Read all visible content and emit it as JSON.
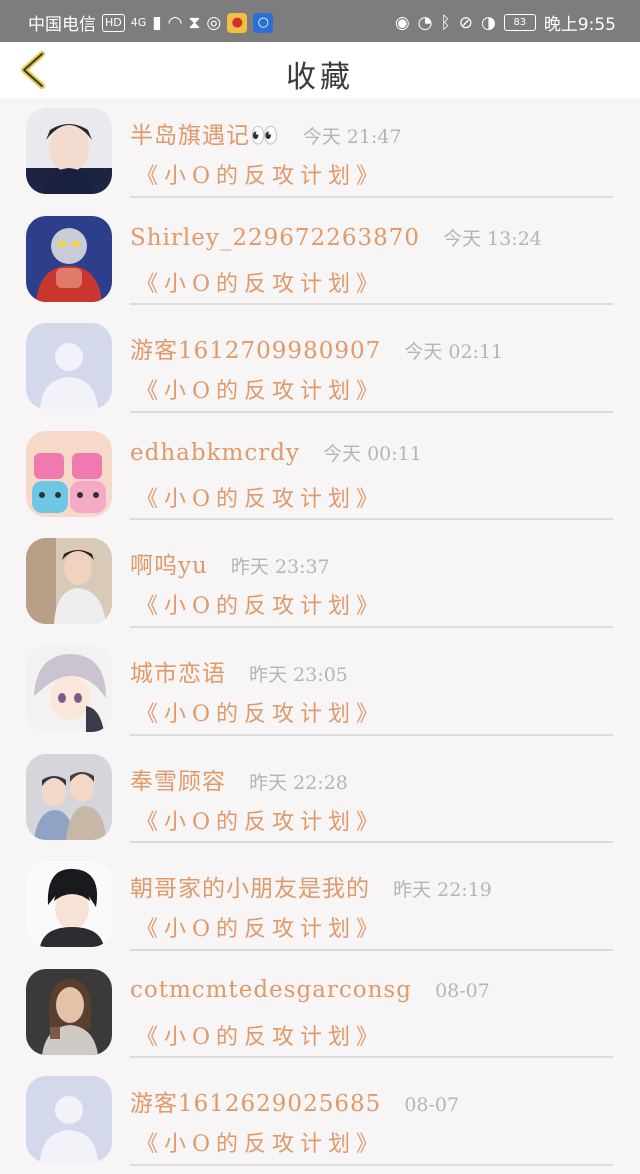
{
  "status_bar": {
    "carrier": "中国电信",
    "hd": "HD",
    "network": "4G",
    "battery": "83",
    "time": "晚上9:55"
  },
  "header": {
    "title": "收藏"
  },
  "colors": {
    "accent": "#e09a6a",
    "time_text": "#b5b5b5",
    "status_bar": "#7d7d7d"
  },
  "items": [
    {
      "name": "半岛旗遇记👀",
      "time": "今天 21:47",
      "book": "《小O的反攻计划》",
      "avatar": "boy-dark-hoodie"
    },
    {
      "name": "Shirley_229672263870",
      "time": "今天 13:24",
      "book": "《小O的反攻计划》",
      "avatar": "ultraman"
    },
    {
      "name": "游客1612709980907",
      "time": "今天 02:11",
      "book": "《小O的反攻计划》",
      "avatar": "default-user"
    },
    {
      "name": "edhabkmcrdy",
      "time": "今天 00:11",
      "book": "《小O的反攻计划》",
      "avatar": "cartoon-cups"
    },
    {
      "name": "啊呜yu",
      "time": "昨天 23:37",
      "book": "《小O的反攻计划》",
      "avatar": "boy-photo"
    },
    {
      "name": "城市恋语",
      "time": "昨天 23:05",
      "book": "《小O的反攻计划》",
      "avatar": "anime-girl"
    },
    {
      "name": "奉雪顾容",
      "time": "昨天 22:28",
      "book": "《小O的反攻计划》",
      "avatar": "two-boys"
    },
    {
      "name": "朝哥家的小朋友是我的",
      "time": "昨天 22:19",
      "book": "《小O的反攻计划》",
      "avatar": "anime-boy"
    },
    {
      "name": "cotmcmtedesgarconsg",
      "time": "08-07",
      "book": "《小O的反攻计划》",
      "avatar": "woman-photo"
    },
    {
      "name": "游客1612629025685",
      "time": "08-07",
      "book": "《小O的反攻计划》",
      "avatar": "default-user"
    }
  ]
}
